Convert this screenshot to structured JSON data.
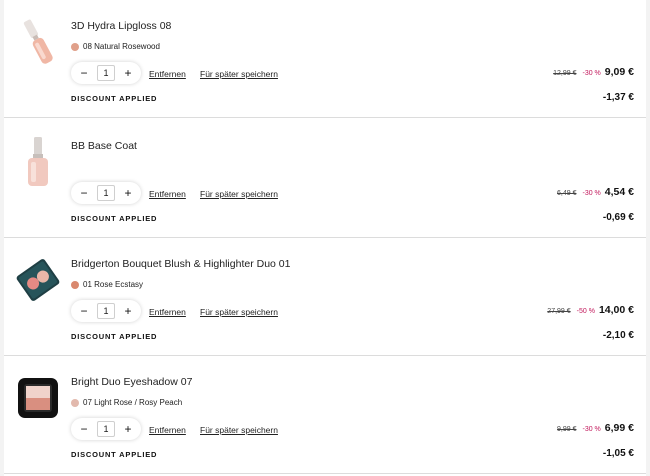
{
  "labels": {
    "remove": "Entfernen",
    "save_later": "Für später speichern",
    "discount_applied": "DISCOUNT APPLIED",
    "minus": "−",
    "plus": "+"
  },
  "items": [
    {
      "title": "3D Hydra Lipgloss 08",
      "variant": "08 Natural Rosewood",
      "swatch_color": "#e0a08a",
      "qty": "1",
      "old_price": "12,99 €",
      "discount_pct": "-30 %",
      "new_price": "9,09 €",
      "discount_amount": "-1,37 €",
      "icon": "lipgloss-icon"
    },
    {
      "title": "BB Base Coat",
      "variant": "",
      "swatch_color": "",
      "qty": "1",
      "old_price": "6,49 €",
      "discount_pct": "-30 %",
      "new_price": "4,54 €",
      "discount_amount": "-0,69 €",
      "icon": "nail-polish-icon"
    },
    {
      "title": "Bridgerton Bouquet Blush & Highlighter Duo 01",
      "variant": "01 Rose Ecstasy",
      "swatch_color": "#d9886e",
      "qty": "1",
      "old_price": "27,99 €",
      "discount_pct": "-50 %",
      "new_price": "14,00 €",
      "discount_amount": "-2,10 €",
      "icon": "blush-palette-icon"
    },
    {
      "title": "Bright Duo Eyeshadow 07",
      "variant": "07 Light Rose / Rosy Peach",
      "swatch_color": "#e2b9ad",
      "qty": "1",
      "old_price": "9,99 €",
      "discount_pct": "-30 %",
      "new_price": "6,99 €",
      "discount_amount": "-1,05 €",
      "icon": "eyeshadow-icon"
    }
  ]
}
